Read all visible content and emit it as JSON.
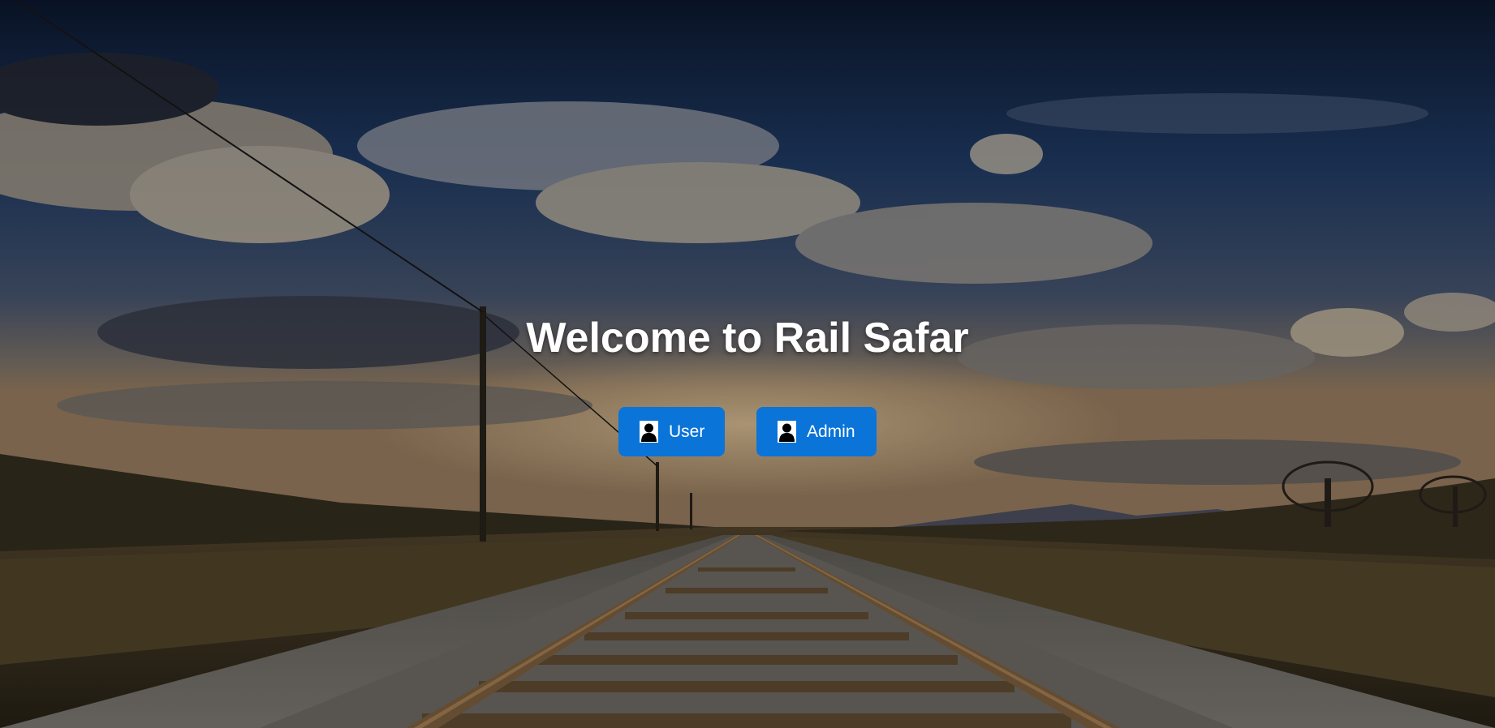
{
  "hero": {
    "title": "Welcome to Rail Safar"
  },
  "buttons": {
    "user_label": "User",
    "admin_label": "Admin"
  },
  "icons": {
    "user": "user-icon",
    "admin": "user-icon"
  },
  "colors": {
    "button_bg": "#0a74d8",
    "text": "#ffffff"
  }
}
